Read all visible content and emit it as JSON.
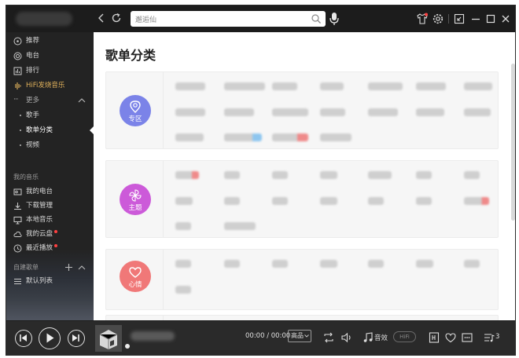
{
  "titlebar": {
    "search_value": "邂逅仙",
    "search_placeholder": "邂逅仙"
  },
  "sidebar": {
    "items": [
      {
        "label": "推荐",
        "icon": "disc-icon"
      },
      {
        "label": "电台",
        "icon": "radio-icon"
      },
      {
        "label": "排行",
        "icon": "chart-icon"
      },
      {
        "label": "HiFi发烧音乐",
        "icon": "waveform-icon"
      }
    ],
    "more_label": "更多",
    "sub_items": [
      "歌手",
      "歌单分类",
      "视频"
    ],
    "my_music_header": "我的音乐",
    "my_items": [
      {
        "label": "我的电台",
        "icon": "radio-box-icon"
      },
      {
        "label": "下载管理",
        "icon": "download-icon"
      },
      {
        "label": "本地音乐",
        "icon": "monitor-icon"
      },
      {
        "label": "我的云盘",
        "icon": "cloud-icon"
      },
      {
        "label": "最近播放",
        "icon": "clock-icon"
      }
    ],
    "playlist_header": "自建歌单",
    "playlists": [
      {
        "label": "默认列表",
        "icon": "list-icon"
      }
    ]
  },
  "main": {
    "title": "歌单分类",
    "categories": [
      {
        "label": "专区",
        "color": "#7b83e8"
      },
      {
        "label": "主题",
        "color": "#cc5ad9"
      },
      {
        "label": "心情",
        "color": "#f07878"
      }
    ]
  },
  "player": {
    "time": "00:00 / 00:00",
    "quality": "高品",
    "sound_effect": "音效",
    "hifi": "HiFi",
    "playlist_count": "3"
  },
  "colors": {
    "accent_gold": "#e3b35c",
    "sidebar_bg": "#232323",
    "player_bg": "#2a2a2a"
  }
}
